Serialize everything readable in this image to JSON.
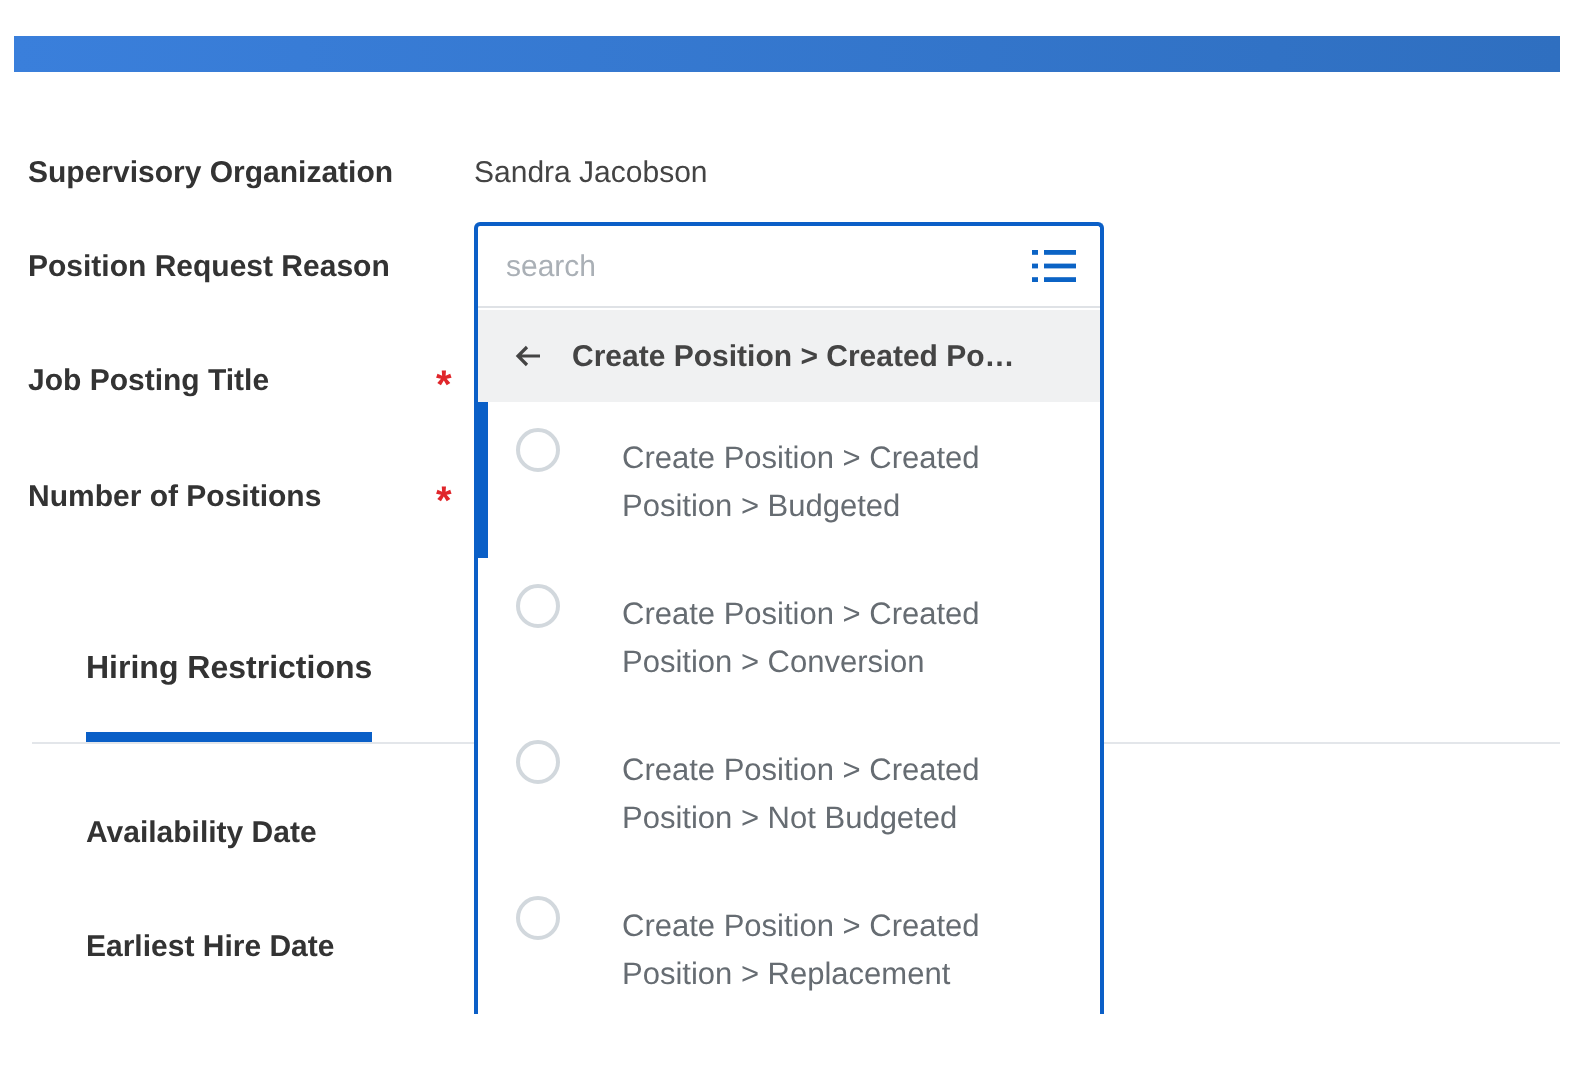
{
  "fields": [
    {
      "label": "Supervisory Organization",
      "value": "Sandra Jacobson"
    },
    {
      "label": "Position Request Reason"
    },
    {
      "label": "Job Posting Title",
      "required_mark": "*"
    },
    {
      "label": "Number of Positions",
      "required_mark": "*"
    }
  ],
  "dropdown": {
    "search": {
      "placeholder": "search"
    },
    "breadcrumb": "Create Position > Created Po…",
    "options": [
      {
        "label": "Create Position > Created Position > Budgeted",
        "highlighted": true,
        "selected": false
      },
      {
        "label": "Create Position > Created Position > Conversion",
        "highlighted": false,
        "selected": false
      },
      {
        "label": "Create Position > Created Position > Not Budgeted",
        "highlighted": false,
        "selected": false
      },
      {
        "label": "Create Position > Created Position > Replacement",
        "highlighted": false,
        "selected": false
      }
    ]
  },
  "tabs": [
    {
      "label": "Hiring Restrictions",
      "selected": true
    }
  ],
  "restriction_fields": [
    {
      "label": "Availability Date"
    },
    {
      "label": "Earliest Hire Date"
    }
  ]
}
